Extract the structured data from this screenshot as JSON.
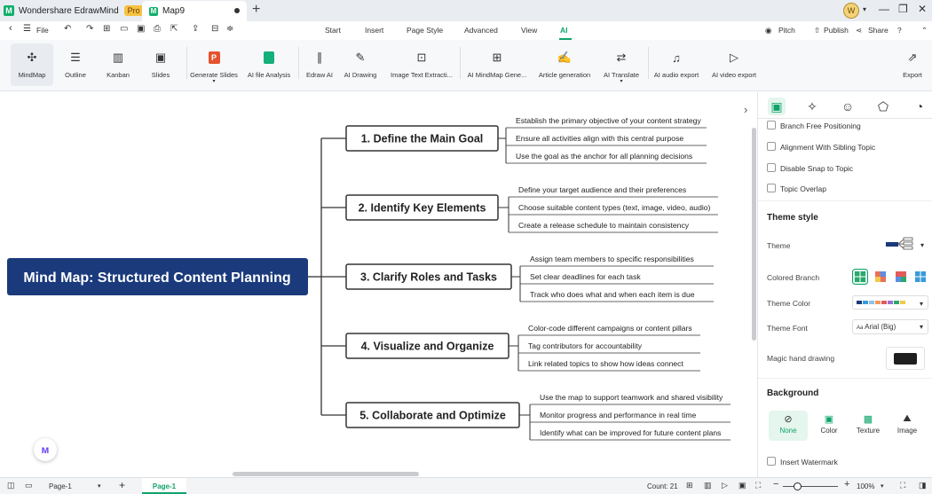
{
  "app": {
    "name": "Wondershare EdrawMind",
    "badge": "Pro",
    "doc_tab": "Map9",
    "avatar_letter": "W"
  },
  "menu": {
    "file": "File",
    "items": [
      "Start",
      "Insert",
      "Page Style",
      "Advanced",
      "View",
      "AI"
    ],
    "active": "AI",
    "right": {
      "pitch": "Pitch",
      "publish": "Publish",
      "share": "Share",
      "help": "?"
    }
  },
  "ribbon": {
    "views": [
      {
        "label": "MindMap",
        "icon": "mindmap-icon"
      },
      {
        "label": "Outline",
        "icon": "outline-icon"
      },
      {
        "label": "Kanban",
        "icon": "kanban-icon"
      },
      {
        "label": "Slides",
        "icon": "slides-icon"
      }
    ],
    "tools": [
      {
        "label": "Generate Slides",
        "icon": "ppt-icon"
      },
      {
        "label": "AI file Analysis",
        "icon": "file-analysis-icon"
      },
      {
        "label": "Edraw AI",
        "icon": "edraw-ai-icon"
      },
      {
        "label": "AI Drawing",
        "icon": "ai-drawing-icon"
      },
      {
        "label": "Image Text Extracti...",
        "icon": "image-text-icon"
      },
      {
        "label": "AI MindMap Gene...",
        "icon": "ai-mindmap-icon"
      },
      {
        "label": "Article generation",
        "icon": "article-icon"
      },
      {
        "label": "AI Translate",
        "icon": "translate-icon"
      },
      {
        "label": "AI audio export",
        "icon": "audio-export-icon"
      },
      {
        "label": "AI video export",
        "icon": "video-export-icon"
      }
    ],
    "export": "Export"
  },
  "mindmap": {
    "central": "Mind Map: Structured Content Planning",
    "topics": [
      {
        "label": "1. Define the Main Goal",
        "subs": [
          "Establish the primary objective of your content strategy",
          "Ensure all activities align with this central purpose",
          "Use the goal as the anchor for all planning decisions"
        ]
      },
      {
        "label": "2. Identify Key Elements",
        "subs": [
          "Define your target audience and their preferences",
          "Choose suitable content types (text, image, video, audio)",
          "Create a release schedule to maintain consistency"
        ]
      },
      {
        "label": "3. Clarify Roles and Tasks",
        "subs": [
          "Assign team members to specific responsibilities",
          "Set clear deadlines for each task",
          "Track who does what and when each item is due"
        ]
      },
      {
        "label": "4. Visualize and Organize",
        "subs": [
          "Color-code different campaigns or content pillars",
          "Tag contributors for accountability",
          "Link related topics to show how ideas connect"
        ]
      },
      {
        "label": "5. Collaborate and Optimize",
        "subs": [
          "Use the map to support teamwork and shared visibility",
          "Monitor progress and performance in real time",
          "Identify what can be improved for future content plans"
        ]
      }
    ]
  },
  "panel": {
    "options": [
      "Branch Free Positioning",
      "Alignment With Sibling Topic",
      "Disable Snap to Topic",
      "Topic Overlap"
    ],
    "theme_style": "Theme style",
    "theme": "Theme",
    "colored_branch": "Colored Branch",
    "theme_color": "Theme Color",
    "theme_font": "Theme Font",
    "font_value": "Arial (Big)",
    "magic_hand": "Magic hand drawing",
    "background": "Background",
    "bg_options": [
      "None",
      "Color",
      "Texture",
      "Image"
    ],
    "bg_selected": "None",
    "watermark": "Insert Watermark",
    "accent": "#10a36a"
  },
  "status": {
    "page_select": "Page-1",
    "page_tab": "Page-1",
    "count": "Count: 21",
    "zoom": "100%"
  },
  "colors": {
    "central_bg": "#1a3a7c",
    "accent": "#10a36a",
    "branch_line": "#333333"
  }
}
